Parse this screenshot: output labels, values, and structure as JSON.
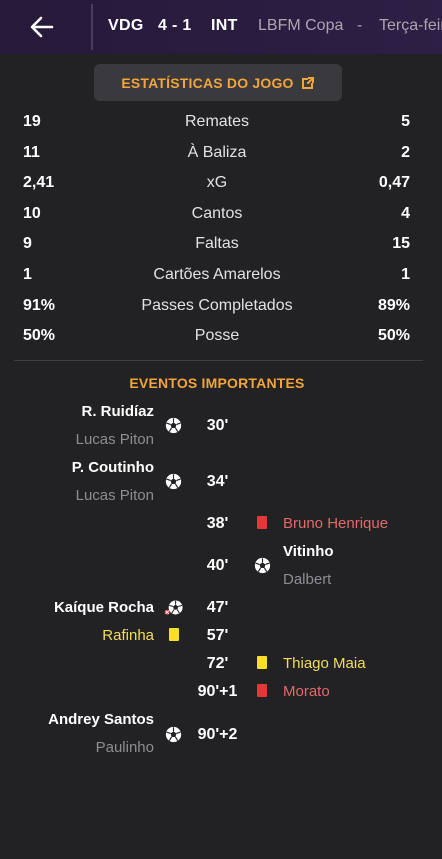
{
  "header": {
    "home_team": "VDG",
    "score": "4 - 1",
    "away_team": "INT",
    "competition": "LBFM Copa",
    "separator": "-",
    "day": "Terça-feira"
  },
  "stats_button": {
    "label": "ESTATÍSTICAS DO JOGO"
  },
  "stats": [
    {
      "home": "19",
      "label": "Remates",
      "away": "5"
    },
    {
      "home": "11",
      "label": "À Baliza",
      "away": "2"
    },
    {
      "home": "2,41",
      "label": "xG",
      "away": "0,47"
    },
    {
      "home": "10",
      "label": "Cantos",
      "away": "4"
    },
    {
      "home": "9",
      "label": "Faltas",
      "away": "15"
    },
    {
      "home": "1",
      "label": "Cartões Amarelos",
      "away": "1"
    },
    {
      "home": "91%",
      "label": "Passes Completados",
      "away": "89%"
    },
    {
      "home": "50%",
      "label": "Posse",
      "away": "50%"
    }
  ],
  "events_title": "EVENTOS IMPORTANTES",
  "events": [
    {
      "side": "home",
      "type": "goal",
      "player": "R. Ruidíaz",
      "assist": "Lucas Piton",
      "minute": "30'"
    },
    {
      "side": "home",
      "type": "goal",
      "player": "P. Coutinho",
      "assist": "Lucas Piton",
      "minute": "34'"
    },
    {
      "side": "away",
      "type": "red_card",
      "player": "Bruno Henrique",
      "minute": "38'"
    },
    {
      "side": "away",
      "type": "goal",
      "player": "Vitinho",
      "assist": "Dalbert",
      "minute": "40'"
    },
    {
      "side": "home",
      "type": "penalty_goal",
      "player": "Kaíque Rocha",
      "minute": "47'"
    },
    {
      "side": "home",
      "type": "yellow_card",
      "player": "Rafinha",
      "minute": "57'"
    },
    {
      "side": "away",
      "type": "yellow_card",
      "player": "Thiago Maia",
      "minute": "72'"
    },
    {
      "side": "away",
      "type": "red_card",
      "player": "Morato",
      "minute": "90'+1"
    },
    {
      "side": "home",
      "type": "goal",
      "player": "Andrey Santos",
      "assist": "Paulinho",
      "minute": "90'+2"
    }
  ],
  "colors": {
    "accent": "#f2a53b",
    "red_card": "#e33838",
    "yellow_card": "#f6de2a",
    "header_bg": "#2a1c3f",
    "body_bg": "#222124"
  },
  "icons": [
    "back-arrow-icon",
    "external-link-icon",
    "football-icon",
    "red-card-icon",
    "yellow-card-icon",
    "penalty-goal-icon"
  ]
}
